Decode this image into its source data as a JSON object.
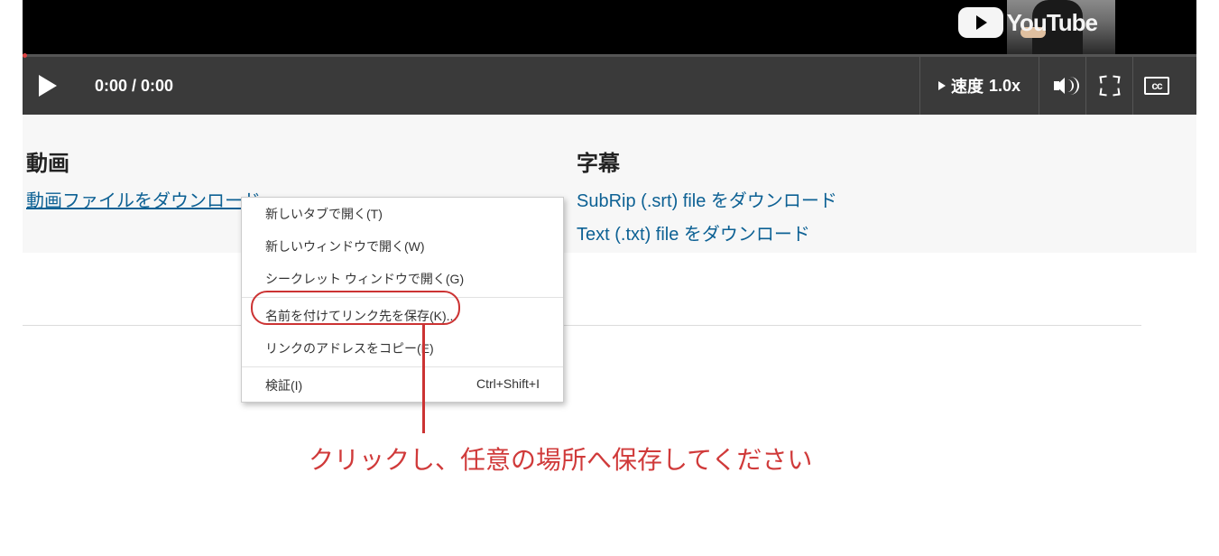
{
  "youtube_brand": "YouTube",
  "player": {
    "time": "0:00 / 0:00",
    "speed_label": "速度",
    "speed_value": "1.0x",
    "cc": "cc"
  },
  "left": {
    "heading": "動画",
    "link": "動画ファイルをダウンロード"
  },
  "right": {
    "heading": "字幕",
    "link_srt": "SubRip (.srt) file をダウンロード",
    "link_txt": "Text (.txt) file をダウンロード"
  },
  "context_menu": {
    "items": [
      "新しいタブで開く(T)",
      "新しいウィンドウで開く(W)",
      "シークレット ウィンドウで開く(G)",
      "名前を付けてリンク先を保存(K)...",
      "リンクのアドレスをコピー(E)",
      "検証(I)"
    ],
    "inspect_shortcut": "Ctrl+Shift+I"
  },
  "annotation": "クリックし、任意の場所へ保存してください"
}
